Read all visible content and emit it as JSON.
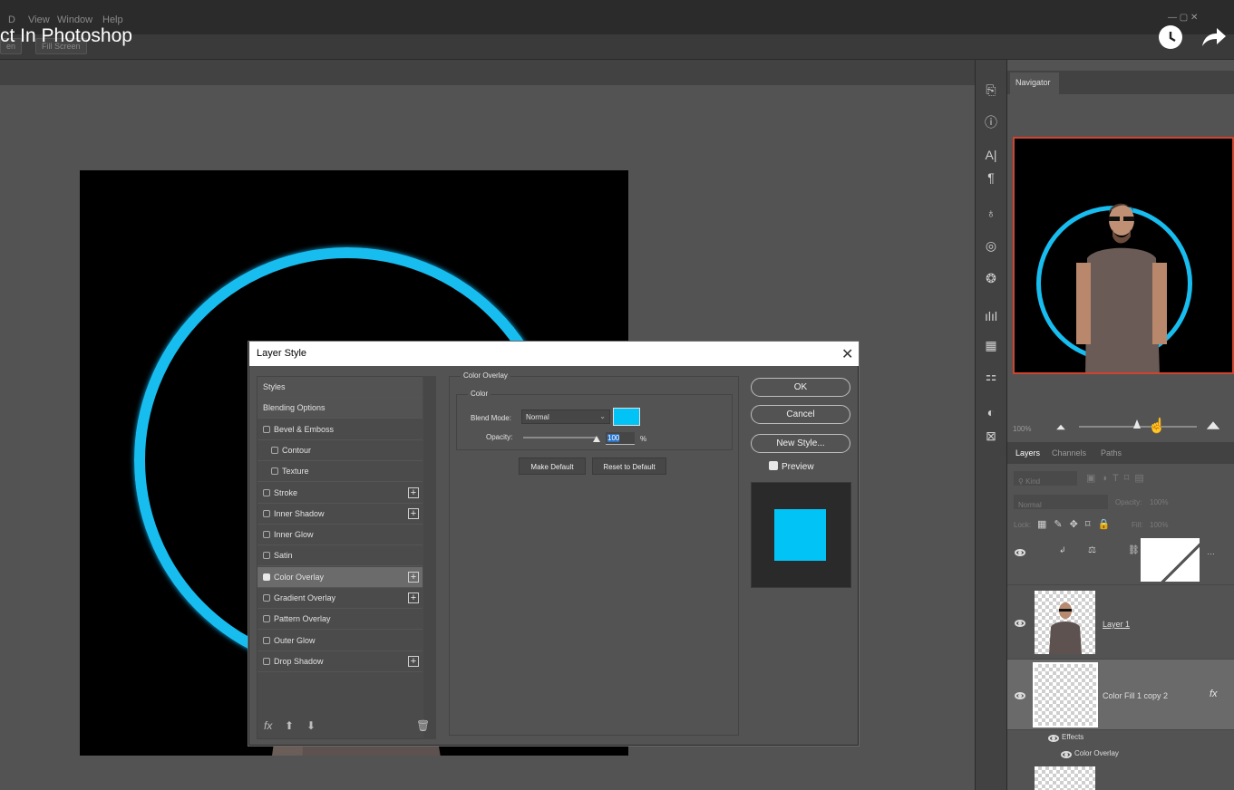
{
  "video": {
    "title": "ct In Photoshop"
  },
  "menubar": {
    "items": [
      "D",
      "View",
      "Window",
      "Help"
    ]
  },
  "options_bar": {
    "buttons": [
      "en",
      "Fill Screen"
    ]
  },
  "navigator": {
    "tab": "Navigator",
    "zoom": "100%"
  },
  "layers_panel": {
    "tabs": [
      "Layers",
      "Channels",
      "Paths"
    ],
    "filter_placeholder": "Kind",
    "blend_mode": "Normal",
    "opacity_label": "Opacity:",
    "opacity_value": "100%",
    "lock_label": "Lock:",
    "fill_label": "Fill:",
    "fill_value": "100%",
    "layers": [
      {
        "name": "Layer 1"
      },
      {
        "name": "Color Fill 1 copy 2",
        "fx": "fx"
      }
    ],
    "effects_label": "Effects",
    "effect_item": "Color Overlay"
  },
  "dialog": {
    "title": "Layer Style",
    "styles": [
      {
        "label": "Styles",
        "checkbox": false,
        "header": true
      },
      {
        "label": "Blending Options",
        "checkbox": false,
        "header": true
      },
      {
        "label": "Bevel & Emboss",
        "checkbox": true,
        "checked": false
      },
      {
        "label": "Contour",
        "checkbox": true,
        "checked": false,
        "indent": true
      },
      {
        "label": "Texture",
        "checkbox": true,
        "checked": false,
        "indent": true
      },
      {
        "label": "Stroke",
        "checkbox": true,
        "checked": false,
        "plus": true
      },
      {
        "label": "Inner Shadow",
        "checkbox": true,
        "checked": false,
        "plus": true
      },
      {
        "label": "Inner Glow",
        "checkbox": true,
        "checked": false
      },
      {
        "label": "Satin",
        "checkbox": true,
        "checked": false
      },
      {
        "label": "Color Overlay",
        "checkbox": true,
        "checked": true,
        "plus": true,
        "active": true
      },
      {
        "label": "Gradient Overlay",
        "checkbox": true,
        "checked": false,
        "plus": true
      },
      {
        "label": "Pattern Overlay",
        "checkbox": true,
        "checked": false
      },
      {
        "label": "Outer Glow",
        "checkbox": true,
        "checked": false
      },
      {
        "label": "Drop Shadow",
        "checkbox": true,
        "checked": false,
        "plus": true
      }
    ],
    "footer_fx": "fx",
    "section_title": "Color Overlay",
    "group_title": "Color",
    "blend_mode_label": "Blend Mode:",
    "blend_mode_value": "Normal",
    "overlay_color": "#02c3f6",
    "opacity_label": "Opacity:",
    "opacity_value": "100",
    "opacity_unit": "%",
    "make_default": "Make Default",
    "reset_default": "Reset to Default",
    "ok": "OK",
    "cancel": "Cancel",
    "new_style": "New Style...",
    "preview_label": "Preview"
  }
}
